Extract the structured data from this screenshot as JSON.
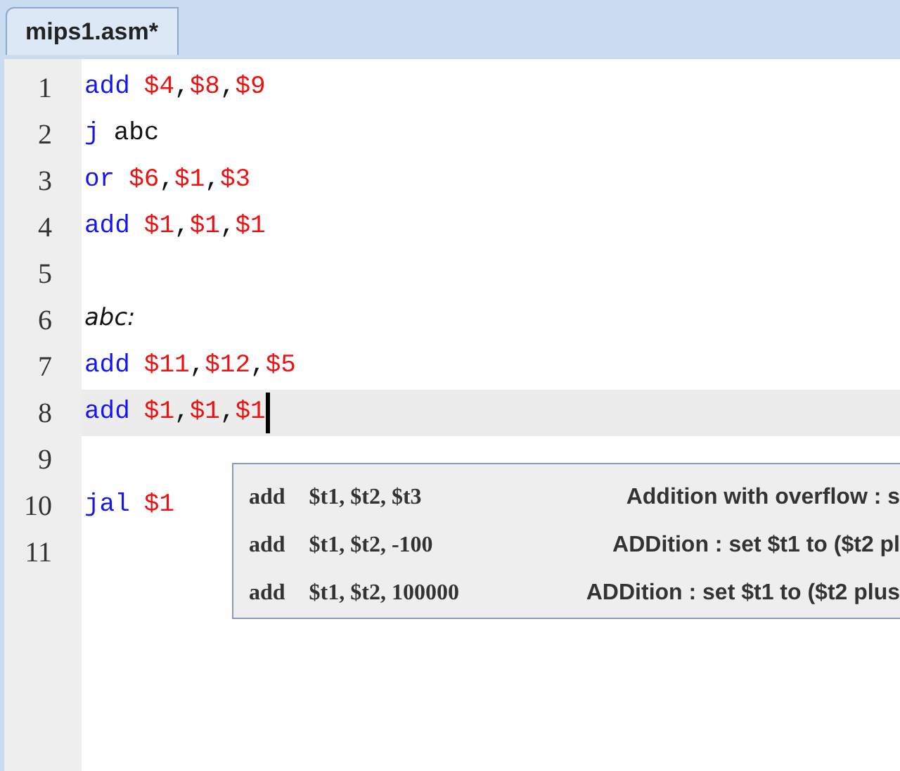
{
  "tab": {
    "label": "mips1.asm*",
    "selected": true
  },
  "editor": {
    "lines": [
      {
        "number": "1",
        "current": false,
        "tokens": [
          {
            "kind": "keyword",
            "text": "add"
          },
          {
            "kind": "register",
            "text": "$4"
          },
          {
            "kind": "plain",
            "text": ","
          },
          {
            "kind": "register",
            "text": "$8"
          },
          {
            "kind": "plain",
            "text": ","
          },
          {
            "kind": "register",
            "text": "$9"
          }
        ]
      },
      {
        "number": "2",
        "current": false,
        "tokens": [
          {
            "kind": "keyword",
            "text": "j"
          },
          {
            "kind": "plain",
            "text": "abc"
          }
        ]
      },
      {
        "number": "3",
        "current": false,
        "tokens": [
          {
            "kind": "keyword",
            "text": "or"
          },
          {
            "kind": "register",
            "text": "$6"
          },
          {
            "kind": "plain",
            "text": ","
          },
          {
            "kind": "register",
            "text": "$1"
          },
          {
            "kind": "plain",
            "text": ","
          },
          {
            "kind": "register",
            "text": "$3"
          }
        ]
      },
      {
        "number": "4",
        "current": false,
        "tokens": [
          {
            "kind": "keyword",
            "text": "add"
          },
          {
            "kind": "register",
            "text": "$1"
          },
          {
            "kind": "plain",
            "text": ","
          },
          {
            "kind": "register",
            "text": "$1"
          },
          {
            "kind": "plain",
            "text": ","
          },
          {
            "kind": "register",
            "text": "$1"
          }
        ]
      },
      {
        "number": "5",
        "current": false
      },
      {
        "number": "6",
        "current": false,
        "tokens": [
          {
            "kind": "label",
            "text": "abc:"
          }
        ]
      },
      {
        "number": "7",
        "current": false,
        "tokens": [
          {
            "kind": "keyword",
            "text": "add"
          },
          {
            "kind": "register",
            "text": "$11"
          },
          {
            "kind": "plain",
            "text": ","
          },
          {
            "kind": "register",
            "text": "$12"
          },
          {
            "kind": "plain",
            "text": ","
          },
          {
            "kind": "register",
            "text": "$5"
          }
        ]
      },
      {
        "number": "8",
        "current": true,
        "tokens": [
          {
            "kind": "keyword",
            "text": "add"
          },
          {
            "kind": "register",
            "text": "$1"
          },
          {
            "kind": "plain",
            "text": ","
          },
          {
            "kind": "register",
            "text": "$1"
          },
          {
            "kind": "plain",
            "text": ","
          },
          {
            "kind": "register",
            "text": "$1"
          }
        ]
      },
      {
        "number": "9",
        "current": false
      },
      {
        "number": "10",
        "current": false,
        "tokens": [
          {
            "kind": "keyword",
            "text": "jal"
          },
          {
            "kind": "register",
            "text": "$1"
          }
        ]
      },
      {
        "number": "11",
        "current": false
      }
    ]
  },
  "autocomplete": {
    "items": [
      {
        "mnemonic": "add",
        "operands": "$t1, $t2, $t3",
        "description": "Addition with overflow : s"
      },
      {
        "mnemonic": "add",
        "operands": "$t1, $t2, -100",
        "description": "ADDition : set $t1 to ($t2 pl"
      },
      {
        "mnemonic": "add",
        "operands": "$t1, $t2, 100000",
        "description": "ADDition : set $t1 to ($t2 plus"
      }
    ]
  }
}
